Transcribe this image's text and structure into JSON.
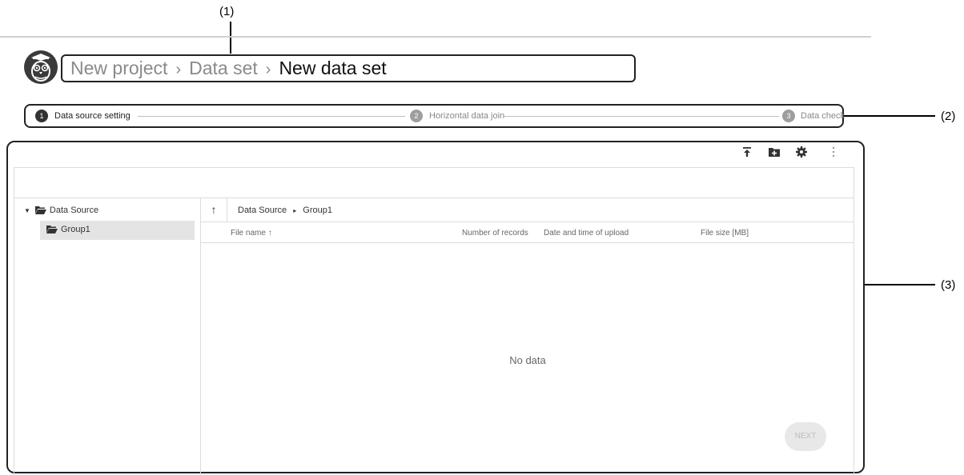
{
  "callouts": {
    "c1": "(1)",
    "c2": "(2)",
    "c3": "(3)"
  },
  "breadcrumb": {
    "project": "New project",
    "dataset": "Data set",
    "current": "New data set",
    "sep": "›"
  },
  "steps": [
    {
      "num": "1",
      "label": "Data source setting",
      "active": true
    },
    {
      "num": "2",
      "label": "Horizontal data join",
      "active": false
    },
    {
      "num": "3",
      "label": "Data check",
      "active": false
    }
  ],
  "toolbar": {
    "icons": [
      "upload-icon",
      "new-folder-icon",
      "settings-icon",
      "more-vert-icon"
    ]
  },
  "tree": {
    "root": "Data Source",
    "child": "Group1"
  },
  "list": {
    "up": "↑",
    "path_root": "Data Source",
    "path_sep": "▸",
    "path_leaf": "Group1",
    "columns": [
      "File name",
      "Number of records",
      "Date and time of upload",
      "File size [MB]"
    ],
    "sort_indicator": "↑",
    "empty_text": "No data"
  },
  "actions": {
    "next_label": "NEXT"
  },
  "colors": {
    "active_step": "#333333",
    "inactive_step": "#9e9e9e",
    "frame": "#222222"
  }
}
